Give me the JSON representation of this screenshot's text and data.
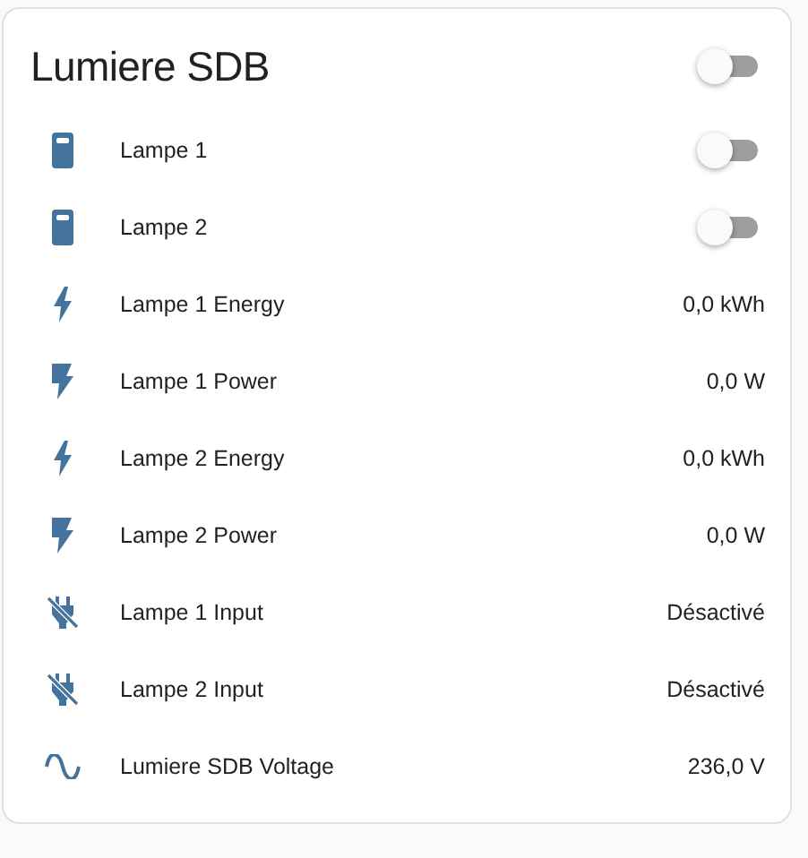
{
  "card": {
    "title": "Lumiere SDB",
    "toggle": {
      "on": false
    },
    "rows": [
      {
        "kind": "switch",
        "name": "Lampe 1",
        "on": false
      },
      {
        "kind": "switch",
        "name": "Lampe 2",
        "on": false
      },
      {
        "kind": "energy",
        "name": "Lampe 1 Energy",
        "value": "0,0 kWh"
      },
      {
        "kind": "power",
        "name": "Lampe 1 Power",
        "value": "0,0 W"
      },
      {
        "kind": "energy",
        "name": "Lampe 2 Energy",
        "value": "0,0 kWh"
      },
      {
        "kind": "power",
        "name": "Lampe 2 Power",
        "value": "0,0 W"
      },
      {
        "kind": "input",
        "name": "Lampe 1 Input",
        "value": "Désactivé"
      },
      {
        "kind": "input",
        "name": "Lampe 2 Input",
        "value": "Désactivé"
      },
      {
        "kind": "voltage",
        "name": "Lumiere SDB Voltage",
        "value": "236,0 V"
      }
    ]
  }
}
